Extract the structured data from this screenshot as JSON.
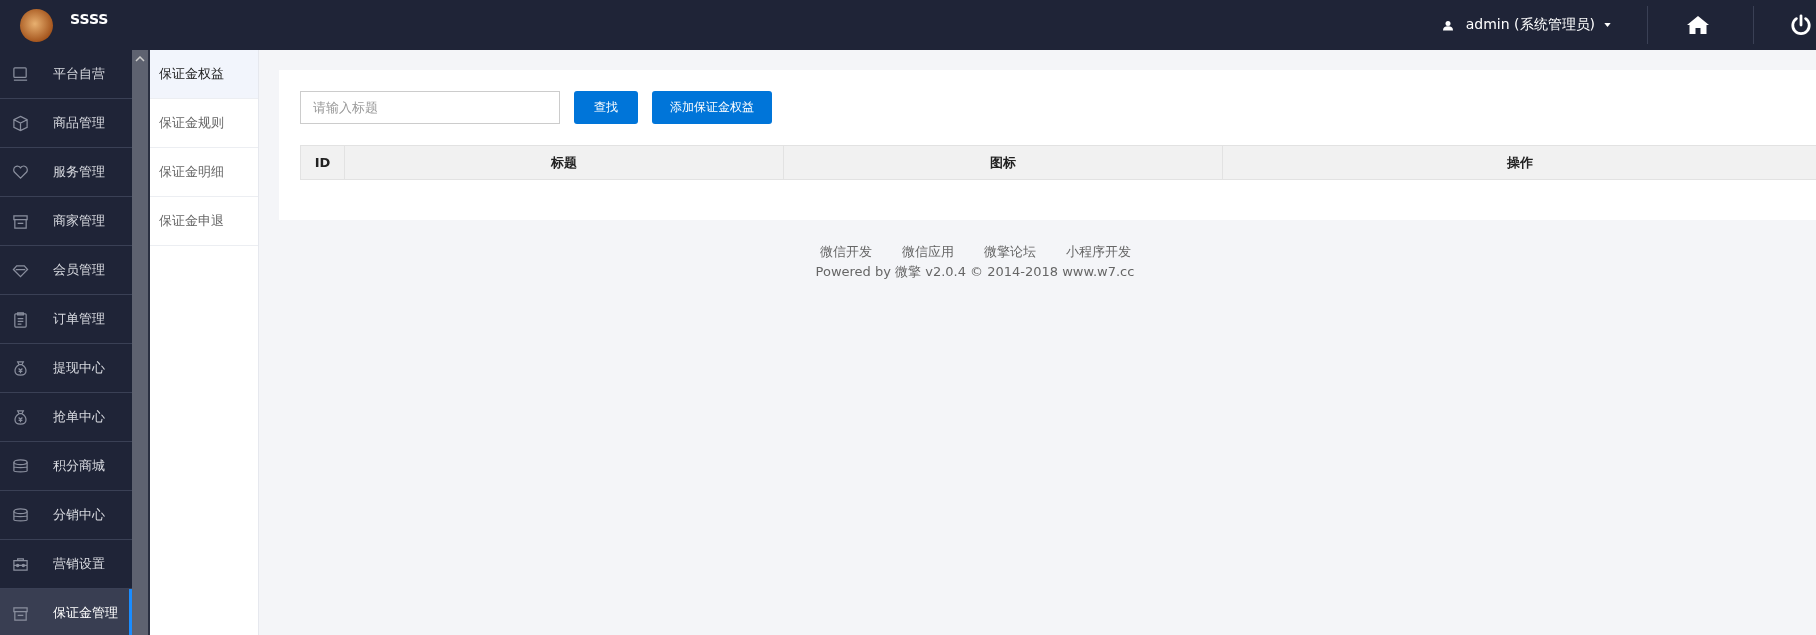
{
  "header": {
    "site_name": "SSSS",
    "user": "admin (系统管理员)"
  },
  "sidebar": {
    "items": [
      {
        "label": "平台自营",
        "selected": false
      },
      {
        "label": "商品管理",
        "selected": false
      },
      {
        "label": "服务管理",
        "selected": false
      },
      {
        "label": "商家管理",
        "selected": false
      },
      {
        "label": "会员管理",
        "selected": false
      },
      {
        "label": "订单管理",
        "selected": false
      },
      {
        "label": "提现中心",
        "selected": false
      },
      {
        "label": "抢单中心",
        "selected": false
      },
      {
        "label": "积分商城",
        "selected": false
      },
      {
        "label": "分销中心",
        "selected": false
      },
      {
        "label": "营销设置",
        "selected": false
      },
      {
        "label": "保证金管理",
        "selected": true
      }
    ]
  },
  "submenu": {
    "items": [
      {
        "label": "保证金权益",
        "selected": true
      },
      {
        "label": "保证金规则",
        "selected": false
      },
      {
        "label": "保证金明细",
        "selected": false
      },
      {
        "label": "保证金申退",
        "selected": false
      }
    ]
  },
  "toolbar": {
    "search": {
      "placeholder": "请输入标题"
    },
    "buttons": [
      "查找",
      "添加保证金权益"
    ]
  },
  "table": {
    "columns": [
      "ID",
      "标题",
      "图标",
      "操作"
    ]
  },
  "footer": {
    "links": [
      "微信开发",
      "微信应用",
      "微擎论坛",
      "小程序开发"
    ],
    "copyright": "Powered by 微擎 v2.0.4 © 2014-2018 www.w7.cc"
  }
}
